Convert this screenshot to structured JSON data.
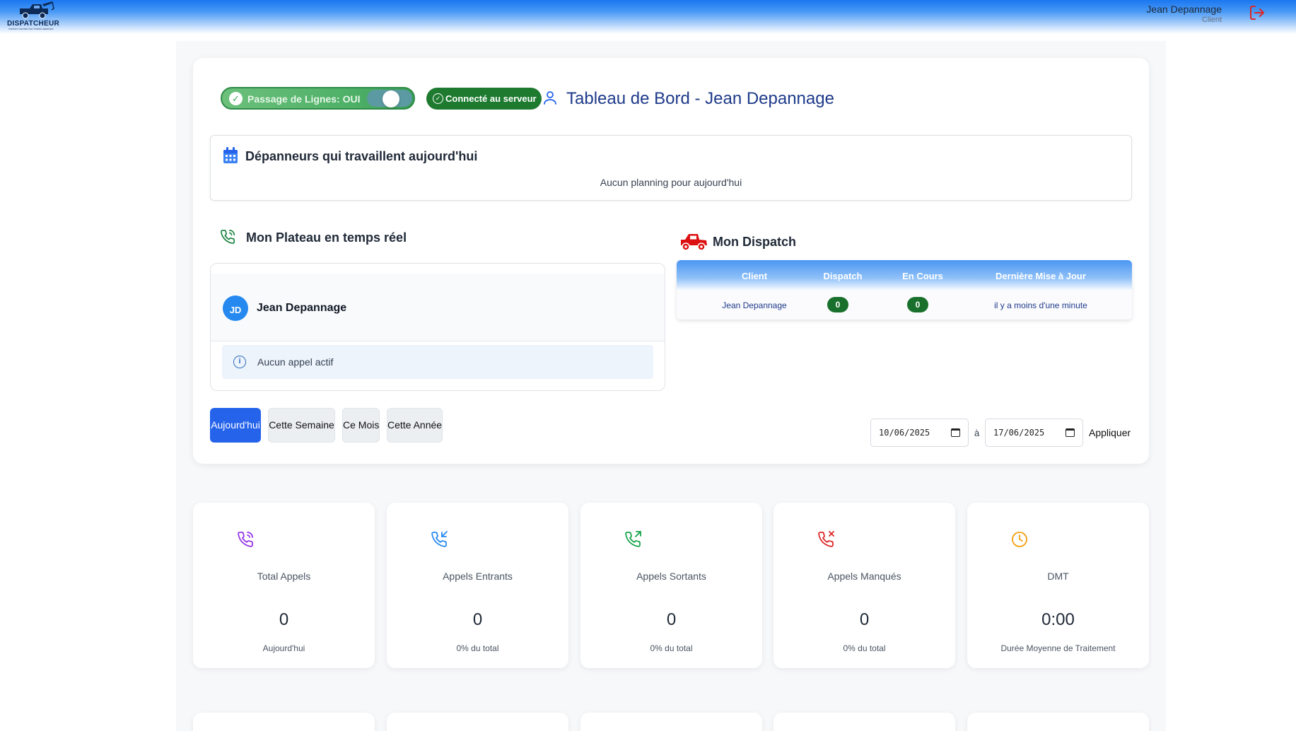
{
  "header": {
    "logo_text": "DISPATCHEUR",
    "logo_subtext": "CONTACT CENTER FOR TOWING SERVICES",
    "user_name": "Jean Depannage",
    "user_role": "Client"
  },
  "controls": {
    "toggle_label": "Passage de Lignes: OUI",
    "toggle_on": true,
    "connection_label": "Connecté au serveur",
    "page_title": "Tableau de Bord - Jean Depannage"
  },
  "depanneurs": {
    "title": "Dépanneurs qui travaillent aujourd'hui",
    "empty_text": "Aucun planning pour aujourd'hui"
  },
  "plateau": {
    "title": "Mon Plateau en temps réel",
    "agent_initials": "JD",
    "agent_name": "Jean Depannage",
    "no_call_text": "Aucun appel actif"
  },
  "dispatch": {
    "title": "Mon Dispatch",
    "columns": [
      "Client",
      "Dispatch",
      "En Cours",
      "Dernière Mise à Jour"
    ],
    "row": {
      "client": "Jean Depannage",
      "dispatch": "0",
      "en_cours": "0",
      "last_update": "il y a moins d'une minute"
    }
  },
  "period": {
    "buttons": [
      "Aujourd'hui",
      "Cette Semaine",
      "Ce Mois",
      "Cette Année"
    ],
    "active": "Aujourd'hui",
    "date_from": "10/06/2025",
    "separator": "à",
    "date_to": "17/06/2025",
    "apply_label": "Appliquer"
  },
  "stats": [
    {
      "icon": "phone-call-icon",
      "color": "#9333ea",
      "label": "Total Appels",
      "value": "0",
      "sub": "Aujourd'hui"
    },
    {
      "icon": "phone-incoming-icon",
      "color": "#2589f0",
      "label": "Appels Entrants",
      "value": "0",
      "sub": "0% du total"
    },
    {
      "icon": "phone-outgoing-icon",
      "color": "#16a34a",
      "label": "Appels Sortants",
      "value": "0",
      "sub": "0% du total"
    },
    {
      "icon": "phone-missed-icon",
      "color": "#dc2626",
      "label": "Appels Manqués",
      "value": "0",
      "sub": "0% du total"
    },
    {
      "icon": "clock-icon",
      "color": "#f59e0b",
      "label": "DMT",
      "value": "0:00",
      "sub": "Durée Moyenne de Traitement"
    }
  ],
  "colors": {
    "primary": "#2563eb",
    "title": "#1e3a8a",
    "success": "#1d7a2f",
    "danger": "#dc2626"
  }
}
